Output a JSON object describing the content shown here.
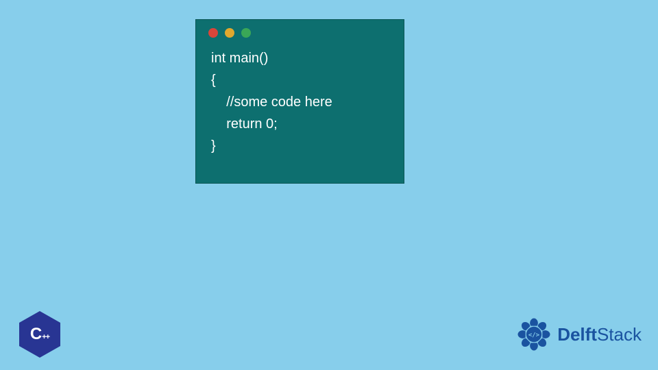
{
  "code": {
    "lines": [
      "int main()",
      "{",
      "    //some code here",
      "    return 0;",
      "}"
    ]
  },
  "window": {
    "dots": [
      "red",
      "yellow",
      "green"
    ]
  },
  "cpp_badge": {
    "letter": "C",
    "suffix": "++"
  },
  "brand": {
    "name_prefix": "Delft",
    "name_suffix": "Stack",
    "icon_glyph": "</>"
  },
  "colors": {
    "background": "#87ceeb",
    "window_bg": "#0d6f6f",
    "brand_blue": "#1a53a0"
  }
}
